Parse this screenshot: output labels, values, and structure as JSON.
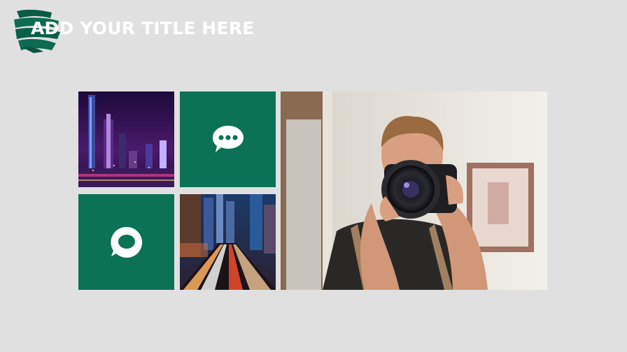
{
  "slide": {
    "title": "ADD YOUR TITLE HERE"
  },
  "colors": {
    "background": "#e0e0e0",
    "accent_green": "#0b7256",
    "title_text": "#ffffff"
  },
  "tiles": [
    {
      "kind": "photo",
      "subject": "night city skyline"
    },
    {
      "kind": "icon",
      "icon": "speech-bubble-dots-icon"
    },
    {
      "kind": "icon",
      "icon": "chat-bubble-icon"
    },
    {
      "kind": "photo",
      "subject": "city traffic light trails"
    }
  ],
  "hero_photo": {
    "subject": "photographer holding camera"
  }
}
